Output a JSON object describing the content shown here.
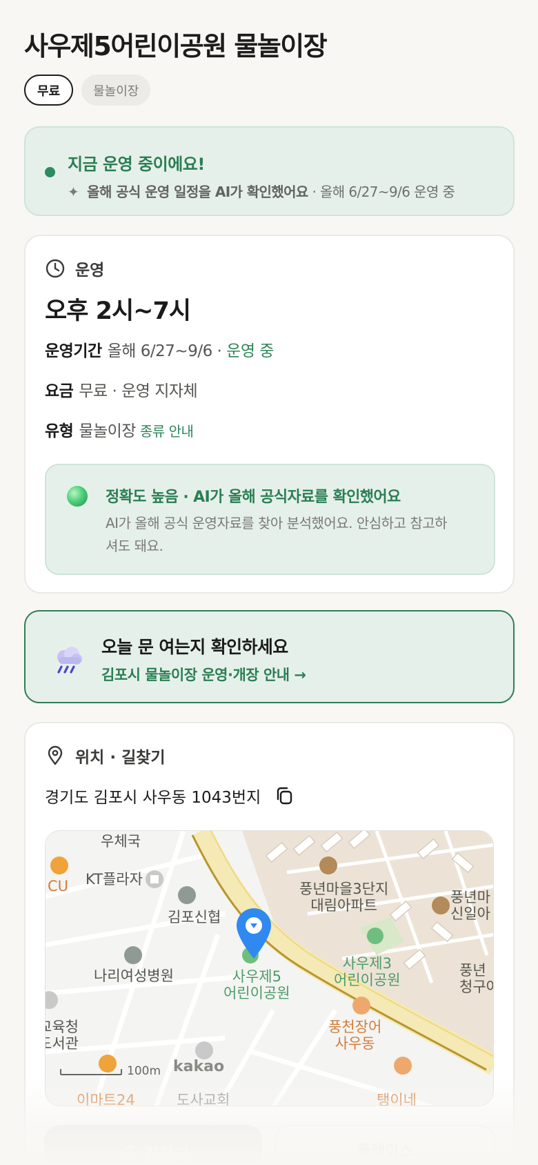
{
  "page": {
    "title": "사우제5어린이공원 물놀이장"
  },
  "tags": {
    "fee": "무료",
    "type": "물놀이장"
  },
  "status": {
    "title": "지금 운영 중이에요!",
    "ai_note": "올해 공식 운영 일정을 AI가 확인했어요",
    "ai_note_suffix": " · 올해 6/27~9/6 운영 중",
    "accent_color": "#2e8b5f"
  },
  "ops": {
    "heading": "운영",
    "hours": "오후 2시~7시",
    "period_label": "운영기간",
    "period_value": "올해 6/27~9/6 · ",
    "period_status": "운영 중",
    "fee_label": "요금",
    "fee_value": "무료 · 운영 지자체",
    "type_label": "유형",
    "type_value": "물놀이장",
    "type_link": "종류 안내",
    "accuracy_title": "정확도 높음 · AI가 올해 공식자료를 확인했어요",
    "accuracy_desc": "AI가 올해 공식 운영자료를 찾아 분석했어요. 안심하고 참고하셔도 돼요."
  },
  "check": {
    "title": "오늘 문 여는지 확인하세요",
    "link": "김포시 물놀이장 운영·개장 안내 →"
  },
  "location": {
    "heading": "위치 · 길찾기",
    "address": "경기도 김포시 사우동 1043번지",
    "map": {
      "labels": {
        "post": "우체국",
        "cu": "CU",
        "kt": "KT플라자",
        "credit": "김포신협",
        "apt3": "풍년마을3단지\n대림아파트",
        "apt_right": "풍년마\n신일아",
        "hospital": "나리여성병원",
        "park5": "사우제5\n어린이공원",
        "park3": "사우제3\n어린이공원",
        "apt_right2": "풍년\n청구아",
        "edu": "교육청\n도서관",
        "eel": "풍천장어\n사우동",
        "mart": "이마트24",
        "church": "도사교회",
        "restaurant": "탱이네",
        "scale": "100m",
        "kakao": "kakao"
      }
    }
  },
  "actions": {
    "directions": "길찾기",
    "place": "플레이스"
  }
}
